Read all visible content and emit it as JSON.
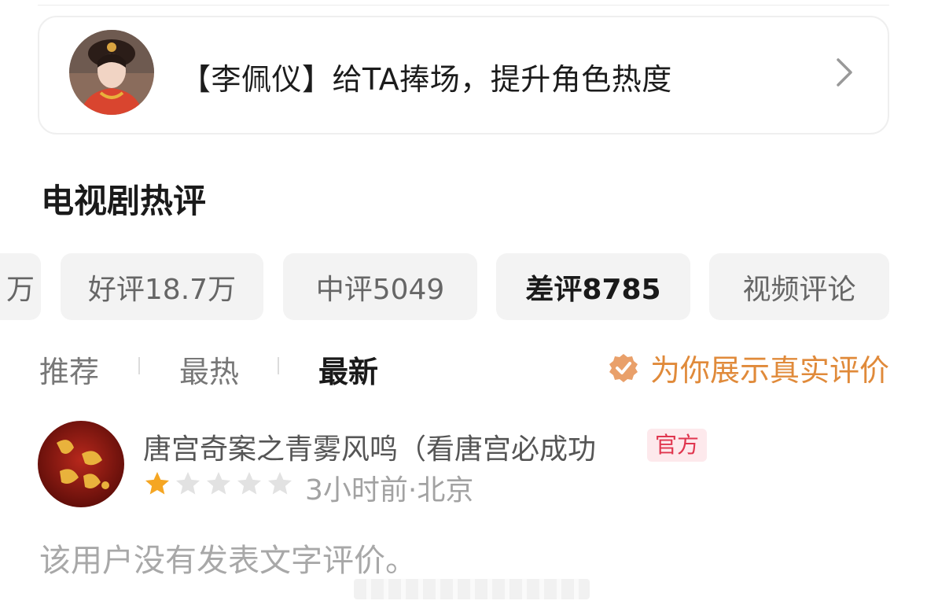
{
  "promo": {
    "text": "【李佩仪】给TA捧场，提升角色热度"
  },
  "section": {
    "title": "电视剧热评"
  },
  "filters": [
    {
      "label": "万"
    },
    {
      "label": "好评18.7万"
    },
    {
      "label": "中评5049"
    },
    {
      "label": "差评8785",
      "active": true
    },
    {
      "label": "视频评论"
    }
  ],
  "sort_tabs": [
    {
      "label": "推荐"
    },
    {
      "label": "最热"
    },
    {
      "label": "最新",
      "active": true
    }
  ],
  "verified_note": {
    "icon": "verified-check-icon",
    "text": "为你展示真实评价",
    "color": "#e08a3a"
  },
  "review": {
    "reviewer_name": "唐宫奇案之青雾风鸣（看唐宫必成功",
    "badge": "官方",
    "rating": 1,
    "rating_max": 5,
    "meta": "3小时前·北京",
    "text": "该用户没有发表文字评价。"
  },
  "colors": {
    "accent_orange": "#e08a3a",
    "badge_red": "#e0364f",
    "star_filled": "#f5a623",
    "star_empty": "#e2e2e2"
  }
}
